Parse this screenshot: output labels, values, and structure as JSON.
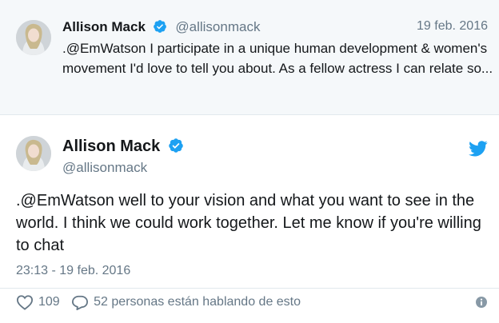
{
  "quoted_tweet": {
    "name": "Allison Mack",
    "handle": "@allisonmack",
    "date": "19 feb. 2016",
    "text": ".@EmWatson I participate in a unique human development & women's movement I'd love to tell you about. As a fellow actress I can relate so..."
  },
  "main_tweet": {
    "name": "Allison Mack",
    "handle": "@allisonmack",
    "text": ".@EmWatson well to your vision and what you want to see in the world. I think we could work together. Let me know if you're willing to chat",
    "timestamp": "23:13 - 19 feb. 2016",
    "likes": "109",
    "talking": "52 personas están hablando de esto"
  },
  "colors": {
    "verified": "#1da1f2",
    "twitter_brand": "#1da1f2",
    "secondary_text": "#657786",
    "quoted_bg": "#f5f8fa"
  },
  "icons": [
    "verified-badge-icon",
    "twitter-bird-icon",
    "heart-icon",
    "reply-bubble-icon",
    "info-icon"
  ]
}
